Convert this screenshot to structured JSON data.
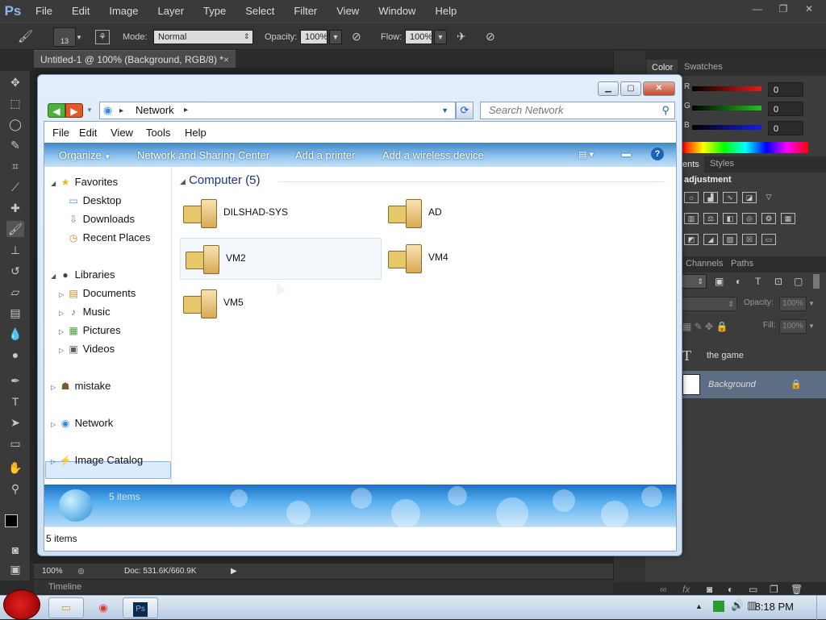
{
  "ps": {
    "logo": "Ps",
    "menu": [
      "File",
      "Edit",
      "Image",
      "Layer",
      "Type",
      "Select",
      "Filter",
      "View",
      "Window",
      "Help"
    ],
    "options": {
      "brush_size": "13",
      "mode_label": "Mode:",
      "mode_value": "Normal",
      "opacity_label": "Opacity:",
      "opacity_value": "100%",
      "flow_label": "Flow:",
      "flow_value": "100%"
    },
    "doc_tab": "Untitled-1 @ 100% (Background, RGB/8) *",
    "doc_tab_close": "×",
    "status": {
      "zoom": "100%",
      "doc": "Doc: 531.6K/660.9K"
    },
    "timeline": "Timeline",
    "panels": {
      "color_tabs": [
        "Color",
        "Swatches"
      ],
      "sliders": [
        {
          "channel": "R",
          "value": "0",
          "color": "#e81a1a"
        },
        {
          "channel": "G",
          "value": "0",
          "color": "#1ec41e"
        },
        {
          "channel": "B",
          "value": "0",
          "color": "#1a1ae8"
        }
      ],
      "adjust_tabs": [
        "ents",
        "Styles"
      ],
      "adjust_title": "adjustment",
      "layer_tabs": [
        "Channels",
        "Paths"
      ],
      "opacity_label": "Opacity:",
      "opacity_value": "100%",
      "fill_label": "Fill:",
      "fill_value": "100%",
      "layers": [
        {
          "name": "the game",
          "type": "text"
        },
        {
          "name": "Background",
          "type": "image",
          "selected": true
        }
      ]
    }
  },
  "explorer": {
    "address": "Network",
    "search_placeholder": "Search Network",
    "menu": [
      "File",
      "Edit",
      "View",
      "Tools",
      "Help"
    ],
    "commands": [
      "Organize",
      "Network and Sharing Center",
      "Add a printer",
      "Add a wireless device"
    ],
    "nav": {
      "favorites": "Favorites",
      "favorites_items": [
        "Desktop",
        "Downloads",
        "Recent Places"
      ],
      "libraries": "Libraries",
      "libraries_items": [
        "Documents",
        "Music",
        "Pictures",
        "Videos"
      ],
      "mistake": "mistake",
      "network": "Network",
      "image_catalog": "Image Catalog"
    },
    "group_header": "Computer (5)",
    "computers": [
      "DILSHAD-SYS",
      "AD",
      "VM2",
      "VM4",
      "VM5"
    ],
    "details_count": "5 items",
    "status_count": "5 items"
  },
  "taskbar": {
    "time": "8:18 PM"
  }
}
